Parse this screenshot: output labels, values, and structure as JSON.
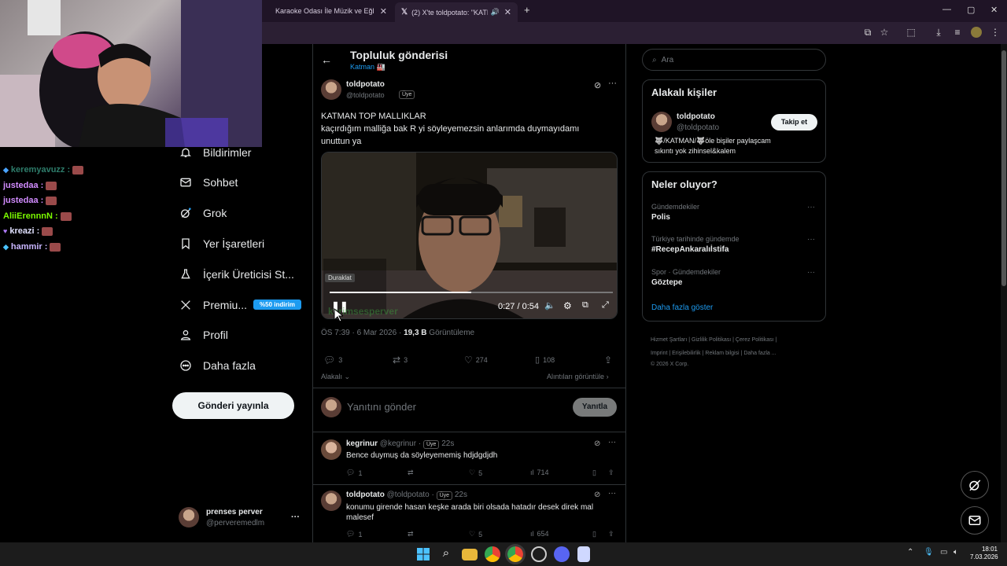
{
  "browser": {
    "tabs": [
      {
        "title": "Karaoke Odası İle Müzik ve Eğl"
      },
      {
        "title": "(2) X'te toldpotato: \"KATMA"
      }
    ],
    "new_tab": "+",
    "window_controls": {
      "minimize": "—",
      "maximize": "▢",
      "close": "✕"
    }
  },
  "chat": {
    "lines": [
      {
        "user": "keremyavuzz :",
        "color": "#2e7d6b"
      },
      {
        "user": "justedaa :",
        "color": "#d28cff"
      },
      {
        "user": "justedaa :",
        "color": "#d28cff"
      },
      {
        "user": "AliiErennnN :",
        "color": "#7cfc00"
      },
      {
        "user": "kreazi :",
        "color": "#e0e0ff"
      },
      {
        "user": "hammir :",
        "color": "#c9b6ff"
      }
    ]
  },
  "nav": {
    "items": [
      {
        "label": "Bildirimler",
        "icon": "bell-icon"
      },
      {
        "label": "Sohbet",
        "icon": "mail-icon"
      },
      {
        "label": "Grok",
        "icon": "grok-icon"
      },
      {
        "label": "Yer İşaretleri",
        "icon": "bookmark-icon"
      },
      {
        "label": "İçerik Üreticisi St...",
        "icon": "flask-icon"
      },
      {
        "label": "Premiu...",
        "icon": "x-logo-icon"
      },
      {
        "label": "Profil",
        "icon": "person-icon"
      },
      {
        "label": "Daha fazla",
        "icon": "more-circle-icon"
      }
    ],
    "premium_badge": "%50 indirim",
    "post_button": "Gönderi yayınla",
    "account": {
      "name": "prenses perver",
      "handle": "@perveremedlm",
      "more": "···"
    }
  },
  "header": {
    "title": "Topluluk gönderisi",
    "subtitle": "Katman 🏭"
  },
  "post": {
    "name": "toldpotato",
    "handle": "@toldpotato",
    "badge": "Üye",
    "text_line1": "KATMAN TOP  MALLIKLAR",
    "text_line2": "kaçırdığım malliğa bak R yi söyleyemezsin anlarımda duymayıdamı",
    "text_line3": "unuttun ya",
    "video": {
      "label": "Duraklat",
      "time": "0:27 / 0:54",
      "progress": 0.5,
      "watermark": "kerimsesperver"
    },
    "meta_time": "ÖS 7:39 · 6 Mar 2026 · ",
    "views": "19,3 B",
    "views_label": " Görüntüleme",
    "actions": {
      "replies": "3",
      "reposts": "3",
      "likes": "274",
      "bookmarks": "108"
    },
    "relevant": "Alakalı",
    "quotes": "Alıntıları görüntüle"
  },
  "reply_box": {
    "placeholder": "Yanıtını gönder",
    "button": "Yanıtla"
  },
  "replies": [
    {
      "name": "kegrinur",
      "handle": "@kegrinur ·",
      "badge": "Üye",
      "time": "22s",
      "text": "Bence duymuş da söyleyememiş hdjdgdjdh",
      "replies": "1",
      "likes": "5",
      "views": "714"
    },
    {
      "name": "toldpotato",
      "handle": "@toldpotato ·",
      "badge": "Üye",
      "time": "22s",
      "text_line1": "konumu girende hasan keşke arada biri olsada hatadır desek direk mal",
      "text_line2": "malesef",
      "replies": "1",
      "likes": "5",
      "views": "654"
    }
  ],
  "sidebar": {
    "search_placeholder": "Ara",
    "related": {
      "title": "Alakalı kişiler",
      "name": "toldpotato",
      "handle": "@toldpotato",
      "follow": "Takip et",
      "bio_line1": "🐺/KATMAN/🐺öle bişiler paylaşcam",
      "bio_line2": "sıkıntı yok zihinsel&kalem"
    },
    "trends": {
      "title": "Neler oluyor?",
      "items": [
        {
          "category": "Gündemdekiler",
          "name": "Polis"
        },
        {
          "category": "Türkiye tarihinde gündemde",
          "name": "#RecepAnkaralıİstifa"
        },
        {
          "category": "Spor · Gündemdekiler",
          "name": "Göztepe"
        }
      ],
      "more": "Daha fazla göster"
    },
    "footer": {
      "line1": [
        "Hizmet Şartları",
        "Gizlilik Politikası",
        "Çerez Politikası"
      ],
      "line2": [
        "Imprint",
        "Erişilebilirlik",
        "Reklam bilgisi",
        "Daha fazla ..."
      ],
      "copyright": "© 2026 X Corp."
    }
  },
  "taskbar": {
    "time": "18:01",
    "date": "7.03.2026"
  }
}
